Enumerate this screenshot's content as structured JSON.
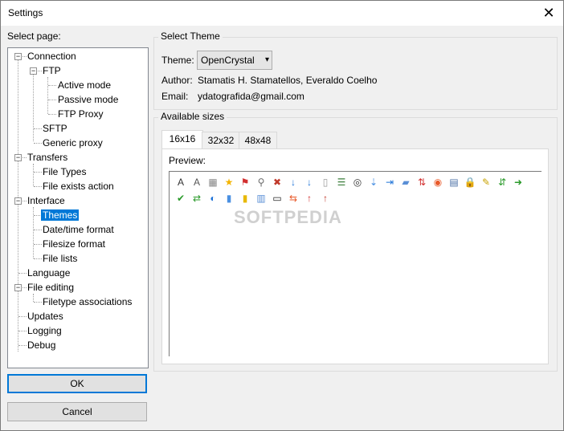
{
  "window": {
    "title": "Settings"
  },
  "left": {
    "label": "Select page:",
    "tree": [
      {
        "label": "Connection"
      },
      {
        "label": "FTP"
      },
      {
        "label": "Active mode"
      },
      {
        "label": "Passive mode"
      },
      {
        "label": "FTP Proxy"
      },
      {
        "label": "SFTP"
      },
      {
        "label": "Generic proxy"
      },
      {
        "label": "Transfers"
      },
      {
        "label": "File Types"
      },
      {
        "label": "File exists action"
      },
      {
        "label": "Interface"
      },
      {
        "label": "Themes"
      },
      {
        "label": "Date/time format"
      },
      {
        "label": "Filesize format"
      },
      {
        "label": "File lists"
      },
      {
        "label": "Language"
      },
      {
        "label": "File editing"
      },
      {
        "label": "Filetype associations"
      },
      {
        "label": "Updates"
      },
      {
        "label": "Logging"
      },
      {
        "label": "Debug"
      }
    ],
    "ok_label": "OK",
    "cancel_label": "Cancel"
  },
  "theme": {
    "group_title": "Select Theme",
    "theme_label": "Theme:",
    "theme_value": "OpenCrystal",
    "author_label": "Author:",
    "author_value": "Stamatis H. Stamatellos, Everaldo Coelho",
    "email_label": "Email:",
    "email_value": "ydatografida@gmail.com"
  },
  "sizes": {
    "group_title": "Available sizes",
    "tabs": [
      "16x16",
      "32x32",
      "48x48"
    ],
    "preview_label": "Preview:",
    "watermark": "SOFTPEDIA"
  },
  "icons": [
    {
      "name": "font-a-icon",
      "glyph": "A",
      "color": "#333333"
    },
    {
      "name": "font-italic-icon",
      "glyph": "A",
      "color": "#555555"
    },
    {
      "name": "text-frame-icon",
      "glyph": "▦",
      "color": "#888888"
    },
    {
      "name": "star-icon",
      "glyph": "★",
      "color": "#f4b400"
    },
    {
      "name": "flag-icon",
      "glyph": "⚑",
      "color": "#d22f2f"
    },
    {
      "name": "search-icon",
      "glyph": "⚲",
      "color": "#6b6b6b"
    },
    {
      "name": "delete-file-icon",
      "glyph": "✖",
      "color": "#c0392b"
    },
    {
      "name": "arrow-down-icon",
      "glyph": "↓",
      "color": "#1e73d8"
    },
    {
      "name": "arrow-down-right-icon",
      "glyph": "↓",
      "color": "#1e73d8"
    },
    {
      "name": "blank-page-icon",
      "glyph": "▯",
      "color": "#9a9a9a"
    },
    {
      "name": "list-page-icon",
      "glyph": "☰",
      "color": "#3a7d3a"
    },
    {
      "name": "binoculars-icon",
      "glyph": "◎",
      "color": "#333333"
    },
    {
      "name": "scroll-up-icon",
      "glyph": "⇣",
      "color": "#4a90e2"
    },
    {
      "name": "arrow-right-bar-icon",
      "glyph": "⇥",
      "color": "#1e73d8"
    },
    {
      "name": "chat-bubble-icon",
      "glyph": "▰",
      "color": "#5a8fd6"
    },
    {
      "name": "sort-updown-icon",
      "glyph": "⇅",
      "color": "#d22f2f"
    },
    {
      "name": "lifebuoy-icon",
      "glyph": "◉",
      "color": "#e85a2a"
    },
    {
      "name": "table-icon",
      "glyph": "▤",
      "color": "#4a6fa5"
    },
    {
      "name": "lock-icon",
      "glyph": "🔒",
      "color": "#6b6b6b"
    },
    {
      "name": "notepad-edit-icon",
      "glyph": "✎",
      "color": "#c8a200"
    },
    {
      "name": "sync-updown-icon",
      "glyph": "⇵",
      "color": "#2a9a2a"
    },
    {
      "name": "arrow-green-right-icon",
      "glyph": "➜",
      "color": "#2a9a2a"
    },
    {
      "name": "check-stack-icon",
      "glyph": "✔",
      "color": "#2a9a2a"
    },
    {
      "name": "refresh-arrows-icon",
      "glyph": "⇄",
      "color": "#2a9a2a"
    },
    {
      "name": "globe-icon",
      "glyph": "◐",
      "color": "#1e73d8"
    },
    {
      "name": "thermometer-icon",
      "glyph": "▮",
      "color": "#4a90e2"
    },
    {
      "name": "yellow-pipe-icon",
      "glyph": "▮",
      "color": "#e8b800"
    },
    {
      "name": "bar-chart-icon",
      "glyph": "▥",
      "color": "#5a8fd6"
    },
    {
      "name": "keyboard-icon",
      "glyph": "▭",
      "color": "#222222"
    },
    {
      "name": "transfer-arrows-icon",
      "glyph": "⇆",
      "color": "#e85a2a"
    },
    {
      "name": "arrow-up-red-icon",
      "glyph": "↑",
      "color": "#d22f2f"
    },
    {
      "name": "arrow-up-green-red-icon",
      "glyph": "↑",
      "color": "#c0392b"
    }
  ]
}
